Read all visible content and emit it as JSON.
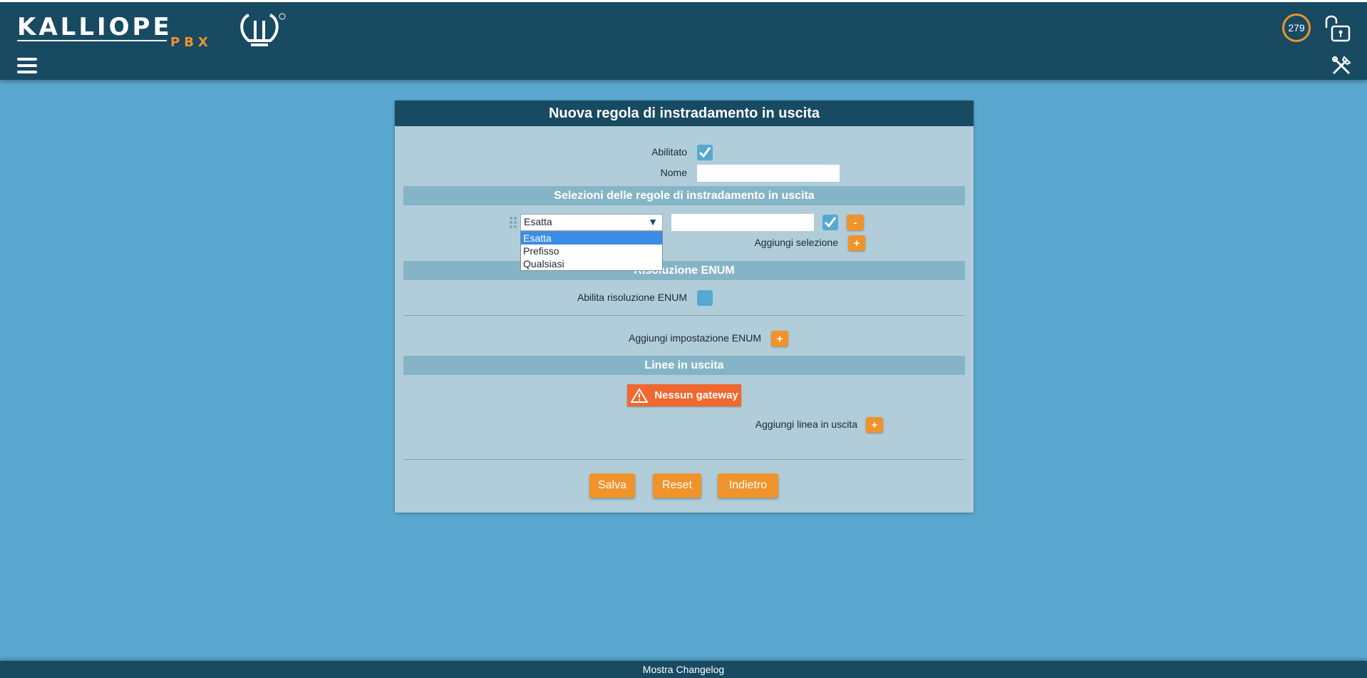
{
  "header": {
    "logo_text": "KALLIOPE",
    "logo_sub": "PBX",
    "counter": "279"
  },
  "panel": {
    "title": "Nuova regola di instradamento in uscita",
    "enabled_label": "Abilitato",
    "name_label": "Nome",
    "name_value": "",
    "selections_section": "Selezioni delle regole di instradamento in uscita",
    "selection_type_value": "Esatta",
    "selection_options": [
      "Esatta",
      "Prefisso",
      "Qualsiasi"
    ],
    "selection_pattern_value": "",
    "remove_label": "-",
    "add_selection_label": "Aggiungi selezione",
    "add_label": "+",
    "enum_section": "Risoluzione ENUM",
    "enum_enable_label": "Abilita risoluzione ENUM",
    "add_enum_label": "Aggiungi impostazione ENUM",
    "lines_section": "Linee in uscita",
    "no_gateway_label": "Nessun gateway",
    "add_line_label": "Aggiungi linea in uscita",
    "save_label": "Salva",
    "reset_label": "Reset",
    "back_label": "Indietro"
  },
  "footer": {
    "changelog_label": "Mostra Changelog"
  },
  "colors": {
    "header_bg": "#184a62",
    "page_bg": "#5aa8cf",
    "panel_bg": "#b1cdd9",
    "accent": "#f0932b",
    "warning": "#f0672f"
  }
}
